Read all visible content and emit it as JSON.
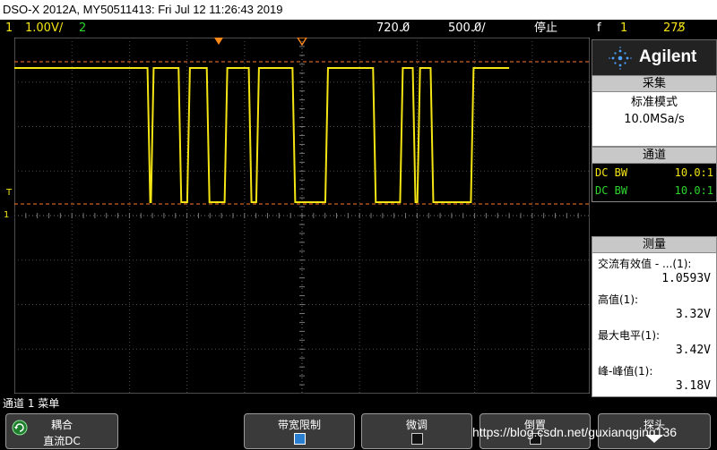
{
  "title": "DSO-X 2012A, MY50511413: Fri Jul 12 11:26:43 2019",
  "status": {
    "ch1_num": "1",
    "ch1_scale": "1.00V/",
    "ch2_num": "2",
    "timebase": "720.0̸",
    "delay": "500.0̸/",
    "run_state": "停止",
    "trigger_slope": "f",
    "trigger_ch": "1",
    "trigger_level": "275̸"
  },
  "panel": {
    "brand": "Agilent",
    "acq_title": "采集",
    "acq_mode": "标准模式",
    "acq_rate": "10.0MSa/s",
    "ch_title": "通道",
    "channels": [
      {
        "coupling": "DC BW",
        "probe": "10.0:1",
        "color": "#f5e414"
      },
      {
        "coupling": "DC BW",
        "probe": "10.0:1",
        "color": "#2ed52e"
      }
    ],
    "meas_title": "测量",
    "measurements": [
      {
        "label": "交流有效值 - ...(1):",
        "value": "1.0593V"
      },
      {
        "label": "高值(1):",
        "value": "3.32V"
      },
      {
        "label": "最大电平(1):",
        "value": "3.42V"
      },
      {
        "label": "峰-峰值(1):",
        "value": "3.18V"
      }
    ]
  },
  "menu": {
    "header": "通道 1 菜单",
    "keys": [
      {
        "line1": "耦合",
        "line2": "直流DC"
      },
      {
        "line1": "带宽限制",
        "line2": ""
      },
      {
        "line1": "微调",
        "line2": ""
      },
      {
        "line1": "倒置",
        "line2": ""
      },
      {
        "line1": "探头",
        "line2": ""
      }
    ]
  },
  "markers": {
    "trigger_label": "T",
    "ch1_label": "1"
  },
  "watermark": "https://blog.csdn.net/guxianqging136",
  "colors": {
    "ch1": "#f5e414",
    "ch2": "#2ed52e",
    "cursor": "#ff7a2a"
  },
  "waveform": {
    "high_level": "3.32V",
    "low_level": "0V",
    "edges_div": [
      2.33,
      2.39,
      2.87,
      3.02,
      3.36,
      3.67,
      4.09,
      4.22,
      4.85,
      5.42,
      6.25,
      6.72,
      6.94,
      7.02,
      7.25,
      7.95
    ]
  }
}
